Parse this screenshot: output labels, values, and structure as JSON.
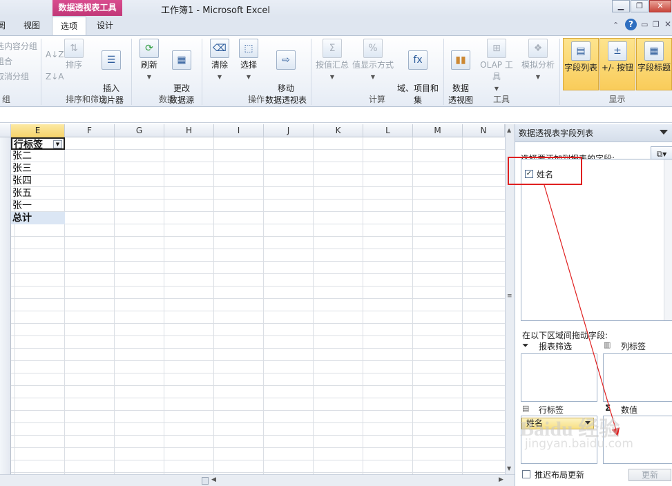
{
  "window": {
    "title": "工作簿1 - Microsoft Excel",
    "context_group": "数据透视表工具"
  },
  "tabs": [
    {
      "label": "阅",
      "active": false
    },
    {
      "label": "视图",
      "active": false
    },
    {
      "label": "选项",
      "active": true
    },
    {
      "label": "设计",
      "active": false
    }
  ],
  "ribbon": {
    "group_partial": {
      "items": [
        "选内容分组",
        "组合",
        "取消分组"
      ],
      "label": "组"
    },
    "sort_filter": {
      "sort": "排序",
      "insert_slicer": "插入\n切片器",
      "label": "排序和筛选"
    },
    "data": {
      "refresh": "刷新",
      "change_source": "更改\n数据源",
      "label": "数据"
    },
    "actions": {
      "clear": "清除",
      "select": "选择",
      "move": "移动\n数据透视表",
      "label": "操作"
    },
    "calc": {
      "summarize": "按值汇总",
      "show_as": "值显示方式",
      "fields_items": "域、项目和\n集",
      "label": "计算"
    },
    "tools": {
      "pivotchart": "数据\n透视图",
      "olap": "OLAP 工具",
      "whatif": "模拟分析",
      "label": "工具"
    },
    "show": {
      "field_list": "字段列表",
      "buttons": "+/- 按钮",
      "headers": "字段标题",
      "label": "显示"
    }
  },
  "columns": [
    "E",
    "F",
    "G",
    "H",
    "I",
    "J",
    "K",
    "L",
    "M",
    "N"
  ],
  "pivot": {
    "header": "行标签",
    "rows": [
      "张二",
      "张三",
      "张四",
      "张五",
      "张一"
    ],
    "total": "总计"
  },
  "pane": {
    "title": "数据透视表字段列表",
    "choose_label": "选择要添加到报表的字段:",
    "fields": [
      {
        "name": "姓名",
        "checked": true
      }
    ],
    "drag_label": "在以下区域间拖动字段:",
    "zones": {
      "filter": "报表筛选",
      "columns": "列标签",
      "rows": "行标签",
      "values": "数值",
      "rows_field": "姓名"
    },
    "defer_label": "推迟布局更新",
    "update_label": "更新"
  },
  "watermark": {
    "brand": "Baidu 经验",
    "url": "jingyan.baidu.com"
  },
  "colors": {
    "accent_context": "#c23878",
    "highlight": "#f9cc5a",
    "annotation": "#e02020"
  }
}
